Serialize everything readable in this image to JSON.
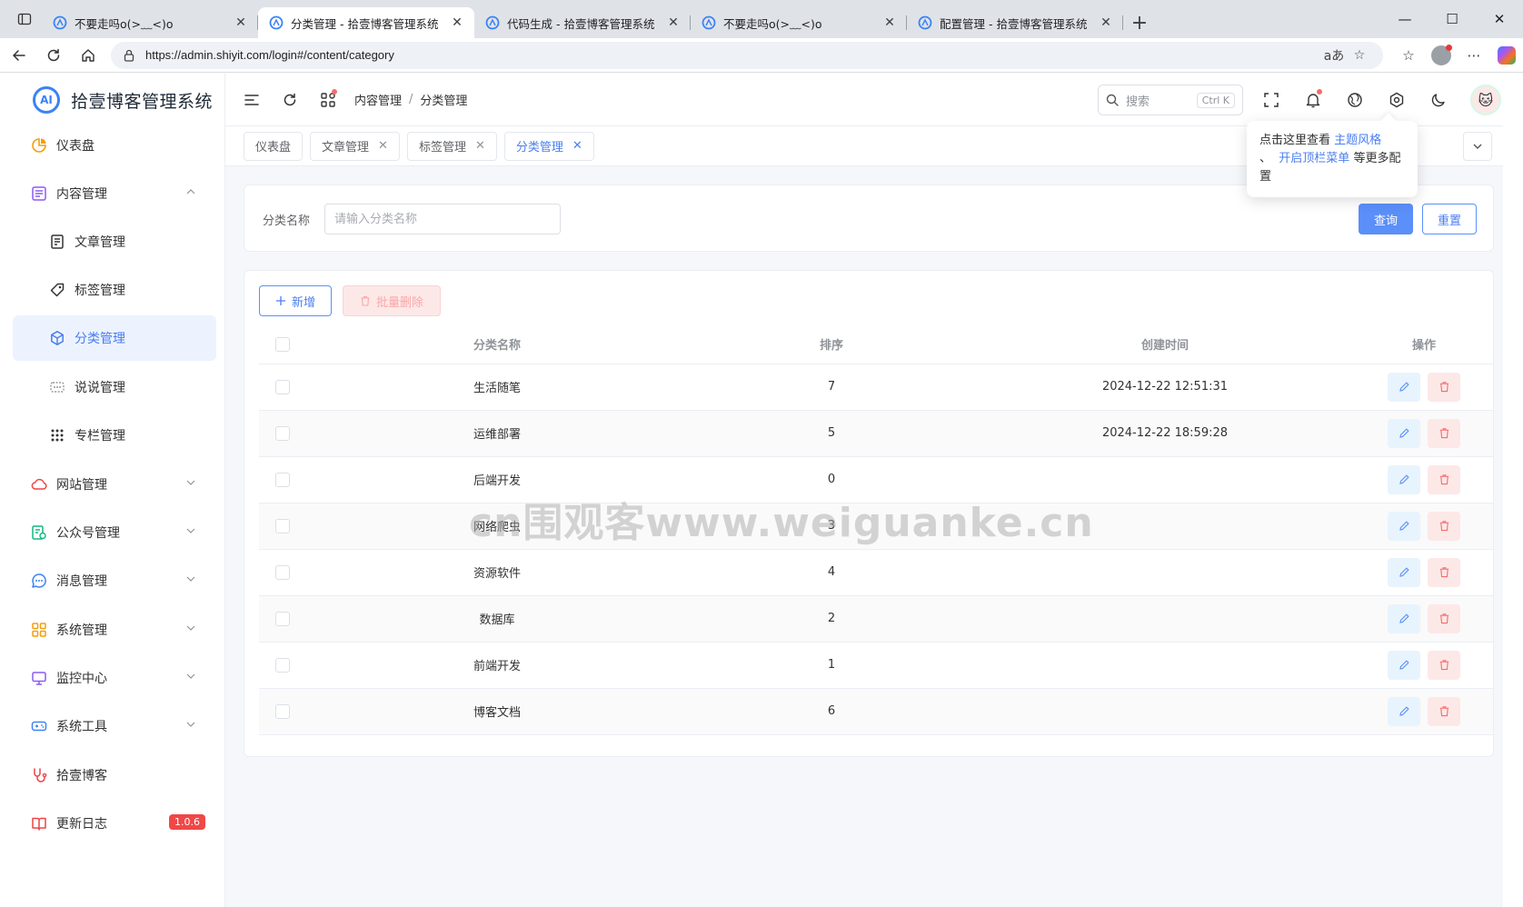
{
  "browser": {
    "tabs": [
      {
        "title": "不要走吗o(>﹏<)o",
        "active": false
      },
      {
        "title": "分类管理 - 拾壹博客管理系统",
        "active": true
      },
      {
        "title": "代码生成 - 拾壹博客管理系统",
        "active": false
      },
      {
        "title": "不要走吗o(>﹏<)o",
        "active": false
      },
      {
        "title": "配置管理 - 拾壹博客管理系统",
        "active": false
      }
    ],
    "url": "https://admin.shiyit.com/login#/content/category",
    "read_aloud": "aあ",
    "new_tab": "+"
  },
  "app": {
    "logo_text": "拾壹博客管理系统",
    "logo_glyph": "AI"
  },
  "sidebar": {
    "items": [
      {
        "label": "仪表盘",
        "icon": "dashboard-icon"
      },
      {
        "label": "内容管理",
        "icon": "content-icon",
        "expanded": true
      },
      {
        "label": "文章管理",
        "icon": "article-icon"
      },
      {
        "label": "标签管理",
        "icon": "tag-icon"
      },
      {
        "label": "分类管理",
        "icon": "category-icon",
        "active": true
      },
      {
        "label": "说说管理",
        "icon": "moment-icon"
      },
      {
        "label": "专栏管理",
        "icon": "column-icon"
      },
      {
        "label": "网站管理",
        "icon": "website-icon"
      },
      {
        "label": "公众号管理",
        "icon": "wechat-icon"
      },
      {
        "label": "消息管理",
        "icon": "message-icon"
      },
      {
        "label": "系统管理",
        "icon": "system-icon"
      },
      {
        "label": "监控中心",
        "icon": "monitor-icon"
      },
      {
        "label": "系统工具",
        "icon": "tool-icon"
      },
      {
        "label": "拾壹博客",
        "icon": "blog-icon"
      },
      {
        "label": "更新日志",
        "icon": "changelog-icon",
        "badge": "1.0.6"
      }
    ]
  },
  "header": {
    "breadcrumb": [
      "内容管理",
      "分类管理"
    ],
    "search_placeholder": "搜索",
    "search_shortcut": "Ctrl K"
  },
  "tags_view": [
    {
      "label": "仪表盘",
      "closable": false
    },
    {
      "label": "文章管理",
      "closable": true
    },
    {
      "label": "标签管理",
      "closable": true
    },
    {
      "label": "分类管理",
      "closable": true,
      "active": true
    }
  ],
  "tooltip": {
    "text1": "点击这里查看",
    "link1": "主题风格",
    "text2": "、",
    "link2": "开启顶栏菜单",
    "text3": "等更多配置"
  },
  "search_form": {
    "label": "分类名称",
    "placeholder": "请输入分类名称",
    "query_label": "查询",
    "reset_label": "重置"
  },
  "toolbar": {
    "add_label": "新增",
    "batch_delete_label": "批量删除"
  },
  "table": {
    "columns": [
      "分类名称",
      "排序",
      "创建时间",
      "操作"
    ],
    "rows": [
      {
        "name": "生活随笔",
        "sort": "7",
        "created": "2024-12-22 12:51:31"
      },
      {
        "name": "运维部署",
        "sort": "5",
        "created": "2024-12-22 18:59:28"
      },
      {
        "name": "后端开发",
        "sort": "0",
        "created": ""
      },
      {
        "name": "网络爬虫",
        "sort": "3",
        "created": ""
      },
      {
        "name": "资源软件",
        "sort": "4",
        "created": ""
      },
      {
        "name": "数据库",
        "sort": "2",
        "created": ""
      },
      {
        "name": "前端开发",
        "sort": "1",
        "created": ""
      },
      {
        "name": "博客文档",
        "sort": "6",
        "created": ""
      }
    ]
  },
  "watermark": "cn围观客www.weiguanke.cn",
  "colors": {
    "primary": "#4a7df1",
    "danger": "#f56c6c",
    "active_bg": "#ecf3fe"
  }
}
